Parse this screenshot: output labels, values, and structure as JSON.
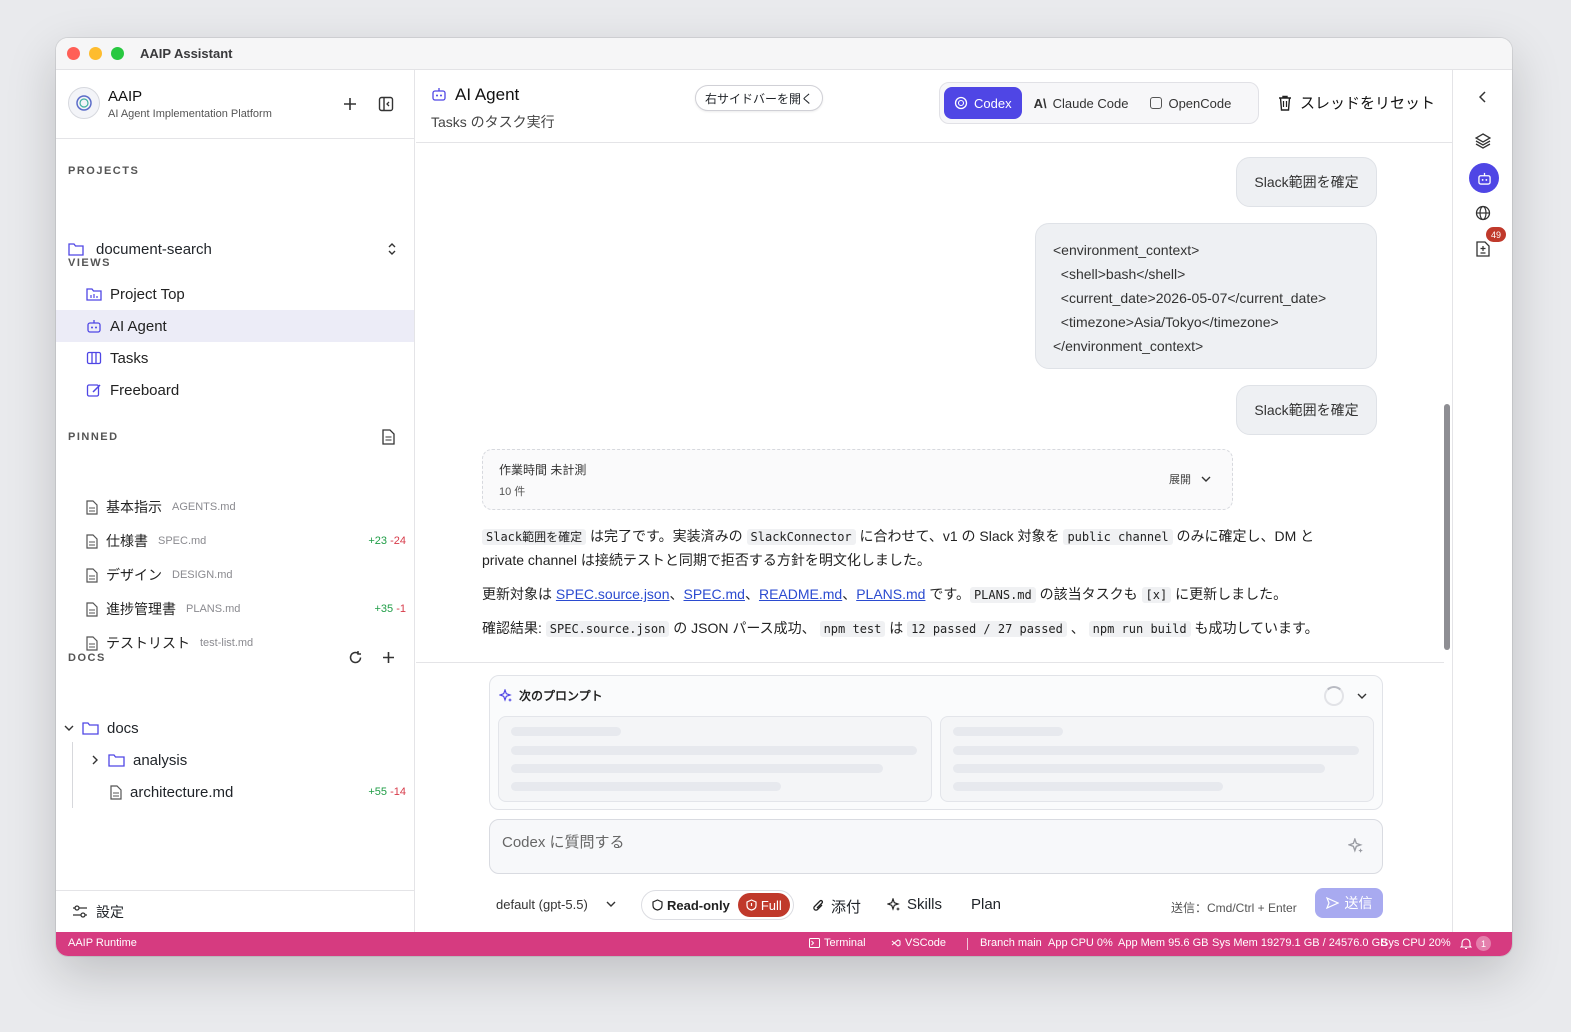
{
  "window": {
    "title": "AAIP Assistant"
  },
  "sidebar": {
    "brand": "AAIP",
    "brand_sub": "AI Agent Implementation Platform",
    "projects_label": "PROJECTS",
    "project_selected": "document-search",
    "views_label": "VIEWS",
    "views": [
      {
        "label": "Project Top",
        "icon": "folder-chart-icon"
      },
      {
        "label": "AI Agent",
        "icon": "robot-icon",
        "active": true
      },
      {
        "label": "Tasks",
        "icon": "columns-icon"
      },
      {
        "label": "Freeboard",
        "icon": "edit-icon"
      }
    ],
    "pinned_label": "PINNED",
    "pinned": [
      {
        "label": "基本指示",
        "file": "AGENTS.md",
        "plus": "",
        "minus": ""
      },
      {
        "label": "仕様書",
        "file": "SPEC.md",
        "plus": "+23",
        "minus": "-24"
      },
      {
        "label": "デザイン",
        "file": "DESIGN.md",
        "plus": "",
        "minus": ""
      },
      {
        "label": "進捗管理書",
        "file": "PLANS.md",
        "plus": "+35",
        "minus": "-1"
      },
      {
        "label": "テストリスト",
        "file": "test-list.md",
        "plus": "",
        "minus": ""
      }
    ],
    "docs_label": "DOCS",
    "docs_tree": {
      "root": "docs",
      "folder": "analysis",
      "file": "architecture.md",
      "file_plus": "+55",
      "file_minus": "-14"
    },
    "settings": "設定"
  },
  "header": {
    "title": "AI Agent",
    "subtitle": "Tasks のタスク実行",
    "open_sidebar": "右サイドバーを開く",
    "engines": [
      "Codex",
      "Claude Code",
      "OpenCode"
    ],
    "engine_selected": "Codex",
    "reset": "スレッドをリセット"
  },
  "chat": {
    "msg1": "Slack範囲を確定",
    "env_lines": [
      "<environment_context>",
      "  <shell>bash</shell>",
      "  <current_date>2026-05-07</current_date>",
      "  <timezone>Asia/Tokyo</timezone>",
      "</environment_context>"
    ],
    "msg2": "Slack範囲を確定",
    "work_title": "作業時間 未計測",
    "work_count": "10 件",
    "work_expand": "展開",
    "p1": {
      "c1": "Slack範囲を確定",
      "t1": " は完了です。実装済みの ",
      "c2": "SlackConnector",
      "t2": " に合わせて、v1 の Slack 対象を ",
      "c3": "public channel",
      "t3": " のみに確定し、DM と",
      "t4": "private channel は接続テストと同期で拒否する方針を明文化しました。"
    },
    "p2": {
      "t1": "更新対象は ",
      "l1": "SPEC.source.json",
      "s1": "、",
      "l2": "SPEC.md",
      "s2": "、",
      "l3": "README.md",
      "s3": "、",
      "l4": "PLANS.md",
      "t2": " です。",
      "c1": "PLANS.md",
      "t3": " の該当タスクも ",
      "c2": "[x]",
      "t4": " に更新しました。"
    },
    "p3": {
      "t1": "確認結果: ",
      "c1": "SPEC.source.json",
      "t2": " の JSON パース成功、 ",
      "c2": "npm test",
      "t3": " は ",
      "c3": "12 passed / 27 passed",
      "t4": " 、 ",
      "c4": "npm run build",
      "t5": " も成功しています。"
    }
  },
  "composer": {
    "next_prompt": "次のプロンプト",
    "placeholder": "Codex に質問する",
    "model": "default (gpt-5.5)",
    "readonly": "Read-only",
    "full": "Full",
    "attach": "添付",
    "skills": "Skills",
    "plan": "Plan",
    "hint": "送信：Cmd/Ctrl + Enter",
    "send": "送信"
  },
  "rail": {
    "badge": "49"
  },
  "statusbar": {
    "runtime": "AAIP Runtime",
    "terminal": "Terminal",
    "vscode": "VSCode",
    "branch": "Branch main",
    "app_cpu": "App CPU 0%",
    "app_mem": "App Mem 95.6 GB",
    "sys_mem": "Sys Mem 19279.1 GB / 24576.0 GB",
    "sys_cpu": "Sys CPU 20%",
    "notif_count": "1"
  },
  "colors": {
    "accent": "#4f46e5",
    "status": "#d63b80",
    "danger": "#c0392b"
  }
}
